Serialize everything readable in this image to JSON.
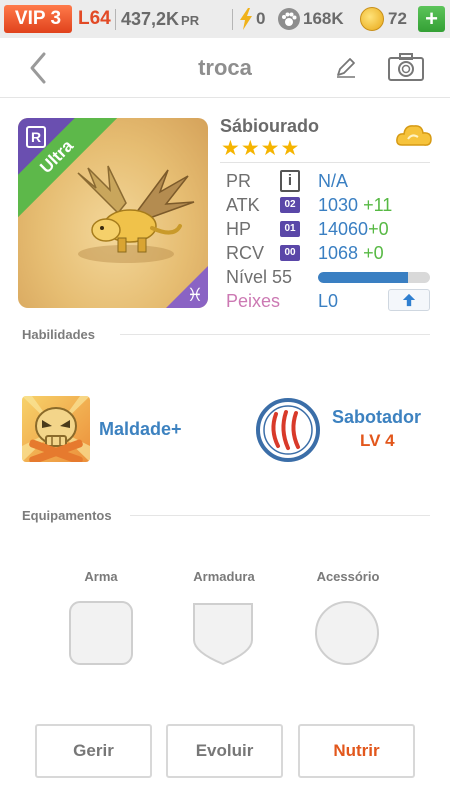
{
  "status_bar": {
    "vip_label": "VIP 3",
    "level_label": "L64",
    "power_value": "437,2K",
    "power_unit": "PR",
    "energy_value": "0",
    "paw_value": "168K",
    "coin_value": "72",
    "plus_label": "+"
  },
  "header": {
    "title": "troca",
    "back_icon": "chevron-left-icon",
    "edit_icon": "pencil-icon",
    "camera_icon": "camera-icon"
  },
  "pet": {
    "name": "Sábiourado",
    "rarity_badge": "R",
    "ribbon_label": "Ultra",
    "stars": "★★★★",
    "star_count": 4,
    "zodiac_symbol": "♓",
    "element_icon": "cloud-icon",
    "stats": {
      "pr": {
        "label": "PR",
        "tag": "i",
        "value": "N/A"
      },
      "atk": {
        "label": "ATK",
        "tag": "02",
        "value": "1030",
        "bonus": "+11"
      },
      "hp": {
        "label": "HP",
        "tag": "01",
        "value": "14060",
        "bonus": "+0"
      },
      "rcv": {
        "label": "RCV",
        "tag": "00",
        "value": "1068",
        "bonus": "+0"
      },
      "level": {
        "label": "Nível 55",
        "progress": 0.8
      },
      "fish": {
        "label": "Peixes",
        "value": "L0",
        "upgrade_icon": "arrow-up-icon"
      }
    }
  },
  "skills": {
    "title": "Habilidades",
    "items": [
      {
        "name": "Maldade+",
        "icon": "skull-icon"
      },
      {
        "name": "Sabotador",
        "level": "LV 4",
        "icon": "claw-marks-icon"
      }
    ]
  },
  "equipment": {
    "title": "Equipamentos",
    "slots": [
      {
        "label": "Arma"
      },
      {
        "label": "Armadura"
      },
      {
        "label": "Acessório"
      }
    ]
  },
  "actions": {
    "manage": "Gerir",
    "evolve": "Evoluir",
    "feed": "Nutrir"
  },
  "colors": {
    "accent_blue": "#3d82c0",
    "bonus_green": "#57b944",
    "vip_orange": "#e0421c",
    "feed_red": "#e2571c",
    "ribbon_green": "#5db84a"
  }
}
